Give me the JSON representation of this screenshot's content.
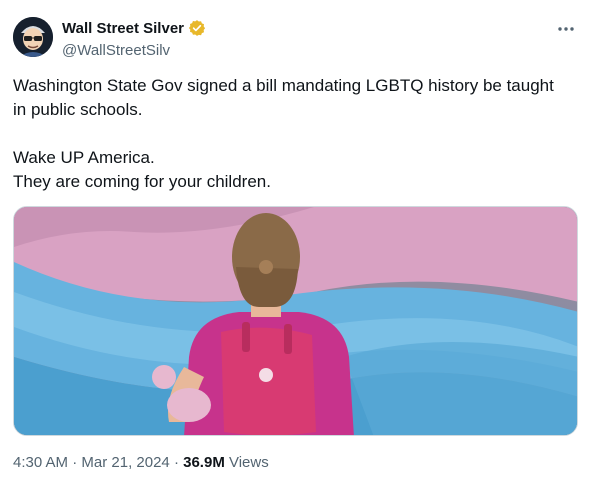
{
  "tweet": {
    "author": {
      "name": "Wall Street Silver",
      "handle": "@WallStreetSilv",
      "verified_color": "#e8b82a"
    },
    "text_lines": [
      "Washington State Gov signed a bill mandating LGBTQ history be taught",
      "in public schools.",
      "Wake UP America.",
      "They are coming for your children."
    ],
    "meta": {
      "time": "4:30 AM",
      "sep1": " · ",
      "date": "Mar 21, 2024",
      "sep2": " · ",
      "views_count": "36.9M",
      "views_label": " Views"
    },
    "colors": {
      "text_primary": "#0f1419",
      "text_secondary": "#536471",
      "border": "#cfd9de",
      "flag_pink": "#e3a7c6",
      "flag_blue": "#5fb0dc"
    },
    "icons": {
      "verified": "verified-badge-icon",
      "more": "more-icon"
    }
  }
}
